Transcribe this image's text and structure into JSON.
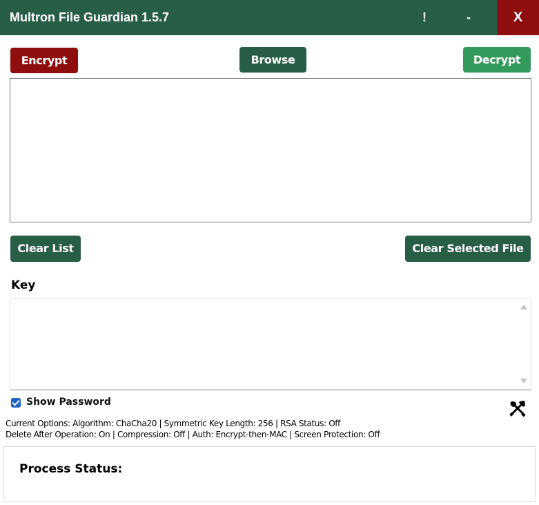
{
  "window": {
    "title": "Multron File Guardian 1.5.7",
    "info_glyph": "!",
    "minimize_glyph": "-",
    "close_glyph": "X"
  },
  "toolbar": {
    "encrypt_label": "Encrypt",
    "browse_label": "Browse",
    "decrypt_label": "Decrypt"
  },
  "file_list": {
    "items": []
  },
  "list_actions": {
    "clear_list_label": "Clear List",
    "clear_selected_label": "Clear Selected File"
  },
  "key": {
    "label": "Key",
    "value": ""
  },
  "show_password": {
    "label": "Show Password",
    "checked": true
  },
  "options": {
    "line1": "Current Options: Algorithm: ChaCha20 | Symmetric Key Length: 256 | RSA Status: Off",
    "line2": "Delete After Operation: On | Compression: Off | Auth: Encrypt-then-MAC | Screen Protection: Off"
  },
  "status": {
    "label": "Process Status:"
  },
  "icons": {
    "settings": "tools-icon"
  },
  "colors": {
    "primary": "#285e45",
    "danger": "#8e0d0d",
    "success": "#349a5b",
    "checkbox": "#1e64c8"
  }
}
